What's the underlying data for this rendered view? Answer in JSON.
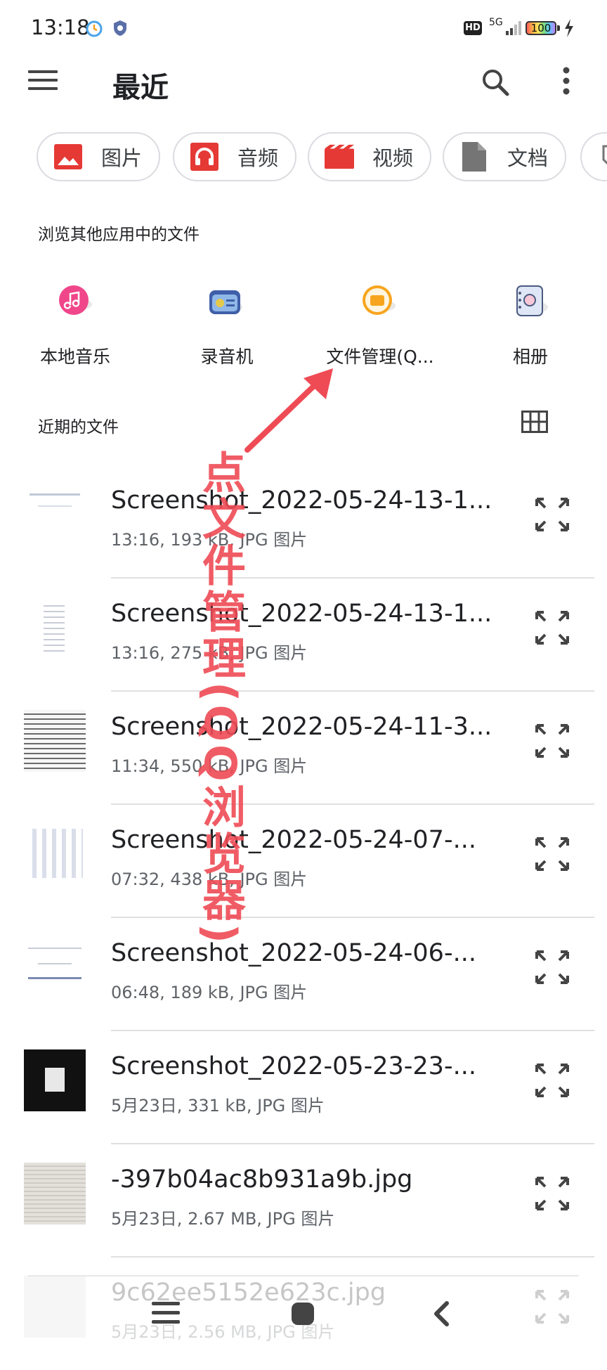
{
  "status_bar": {
    "time": "13:18",
    "hd": "HD",
    "network": "5G",
    "battery": "100",
    "icons": [
      "alarm-icon",
      "shield-icon",
      "signal-icon",
      "charge-icon"
    ]
  },
  "app_bar": {
    "title": "最近",
    "icons": [
      "menu-icon",
      "search-icon",
      "more-vert-icon"
    ]
  },
  "chips": [
    {
      "label": "图片",
      "icon": "image-icon",
      "color": "#e53935"
    },
    {
      "label": "音频",
      "icon": "headphones-icon",
      "color": "#e53935"
    },
    {
      "label": "视频",
      "icon": "video-icon",
      "color": "#e53935"
    },
    {
      "label": "文档",
      "icon": "document-icon",
      "color": "#757575"
    }
  ],
  "apps_section": {
    "label": "浏览其他应用中的文件",
    "apps": [
      {
        "label": "本地音乐",
        "icon": "music-app-icon"
      },
      {
        "label": "录音机",
        "icon": "recorder-app-icon"
      },
      {
        "label": "文件管理(Q...",
        "icon": "file-manager-app-icon"
      },
      {
        "label": "相册",
        "icon": "gallery-app-icon"
      }
    ]
  },
  "recent_section": {
    "label": "近期的文件",
    "files": [
      {
        "name": "Screenshot_2022-05-24-13-1...",
        "meta": "13:16, 193 kB, JPG 图片"
      },
      {
        "name": "Screenshot_2022-05-24-13-1...",
        "meta": "13:16, 275 kB, JPG 图片"
      },
      {
        "name": "Screenshot_2022-05-24-11-3...",
        "meta": "11:34, 550 kB, JPG 图片"
      },
      {
        "name": "Screenshot_2022-05-24-07-...",
        "meta": "07:32, 438 kB, JPG 图片"
      },
      {
        "name": "Screenshot_2022-05-24-06-...",
        "meta": "06:48, 189 kB, JPG 图片"
      },
      {
        "name": "Screenshot_2022-05-23-23-...",
        "meta": "5月23日, 331 kB, JPG 图片"
      },
      {
        "name": "-397b04ac8b931a9b.jpg",
        "meta": "5月23日, 2.67 MB, JPG 图片"
      },
      {
        "name": "9c62ee5152e623c.jpg",
        "meta": "5月23日, 2.56 MB, JPG 图片"
      }
    ]
  },
  "annotation": {
    "text": "点文件管理(QQ浏览器)",
    "color": "#ef4b55"
  },
  "colors": {
    "chip_border": "#dadce0",
    "divider": "#e0e0e0",
    "meta_text": "#5f6368"
  }
}
